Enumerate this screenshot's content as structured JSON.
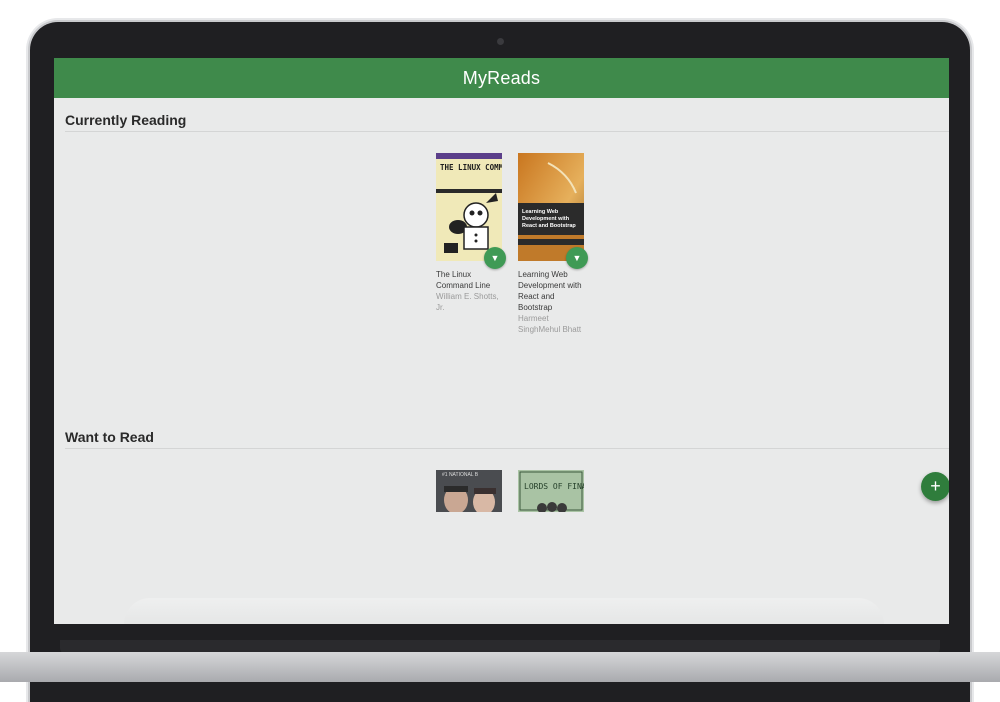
{
  "app": {
    "title": "MyReads"
  },
  "shelves": [
    {
      "title": "Currently Reading",
      "books": [
        {
          "title": "The Linux Command Line",
          "author": "William E. Shotts, Jr.",
          "cover_text": "THE LINUX COMMAND LINE"
        },
        {
          "title": "Learning Web Development with React and Bootstrap",
          "author": "Harmeet SinghMehul Bhatt",
          "cover_text": "Learning Web Development with React and Bootstrap"
        }
      ]
    },
    {
      "title": "Want to Read",
      "books": [
        {
          "cover_text": "#1 NATIONAL B"
        },
        {
          "cover_text": "LORDS OF FINANC"
        }
      ]
    }
  ],
  "icons": {
    "shelf_changer": "chevron-down-icon",
    "add": "plus-icon"
  },
  "colors": {
    "appbar": "#3f8a4b",
    "fab": "#2f7d3c",
    "shelf_changer": "#3f9a55"
  }
}
